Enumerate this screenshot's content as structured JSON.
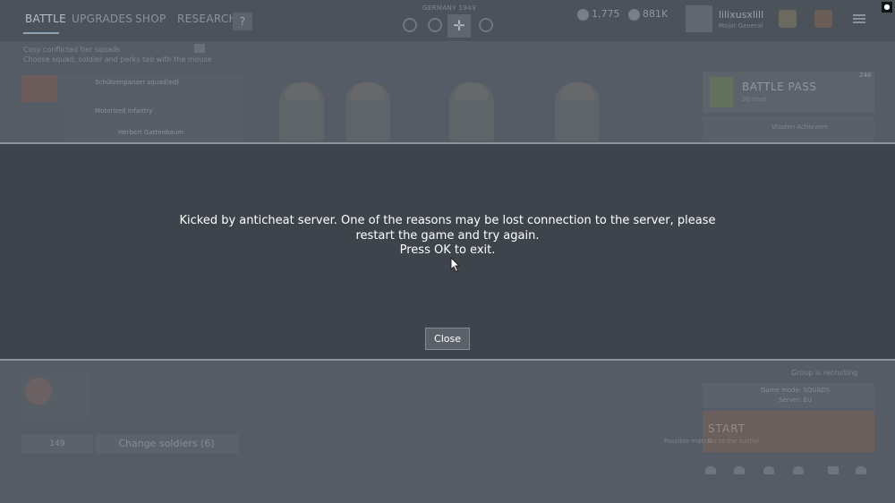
{
  "nav": {
    "tabs": [
      {
        "label": "BATTLE",
        "active": true
      },
      {
        "label": "UPGRADES",
        "active": false
      },
      {
        "label": "SHOP",
        "active": false
      },
      {
        "label": "RESEARCH",
        "active": false
      }
    ],
    "help": "?",
    "nation_label": "GERMANY 1943"
  },
  "currency": {
    "gold": "1,775",
    "silver": "881K"
  },
  "profile": {
    "name": "lilixusxlill",
    "rank": "Major General"
  },
  "notice": {
    "line1": "Cosy conflicted tier squads",
    "line2": "Choose squad, soldier and perks tab with the mouse"
  },
  "squads": [
    {
      "name": "Schützenpanzer squad(ed)",
      "count": "201 / 6"
    },
    {
      "name": "Motorized Infantry",
      "count": ""
    },
    {
      "name": "Herbert Gattenbaum",
      "count": "4 / 1"
    }
  ],
  "battle_pass": {
    "title": "BATTLE PASS",
    "subtitle": "30 level",
    "count": "248",
    "item": "Vlasten Achievem"
  },
  "bottom": {
    "soldiers_count": "149",
    "change_soldiers": "Change soldiers (6)",
    "group_recruiting": "Group is recruiting",
    "game_mode_line1": "Game mode: SQUADS",
    "game_mode_line2": "Server: EU",
    "start": "START",
    "start_sub": "Go to the battle!",
    "possible_match": "Possible match:"
  },
  "modal": {
    "message_lines": [
      "Kicked by anticheat server. One of the reasons may be lost connection to the server, please",
      "restart the game and try again.",
      "Press OK to exit."
    ],
    "close_label": "Close"
  },
  "colors": {
    "overlay_bg": "#565c65",
    "modal_bg": "#3e444c",
    "modal_border": "#8e949b",
    "button_bg": "#5b6168",
    "text": "#ffffff"
  }
}
